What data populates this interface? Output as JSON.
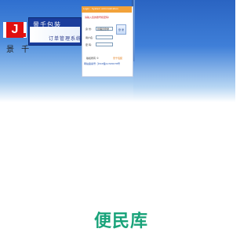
{
  "brand": {
    "logo_letter": "J",
    "logo_sub": "景 千",
    "company_name": "景千包装",
    "system_title": "订单管理系统"
  },
  "login": {
    "header": "Login · System Administration",
    "notice": "请输入您的账号和密码!",
    "identity_label": "身 份:",
    "identity_value": "管理员登录",
    "username_label": "用户名:",
    "password_label": "密 码:",
    "login_button": "登 录",
    "footer_prefix": "版权所有 ©",
    "footer_link": "景千包装",
    "footer_line2": "网站备案号: 沪ICP备12345678号"
  },
  "watermark": "便民库",
  "colors": {
    "brand_red": "#e01010",
    "brand_blue": "#1a3d9c",
    "header_orange": "#f2a23a",
    "watermark_green": "#1aa37a"
  }
}
